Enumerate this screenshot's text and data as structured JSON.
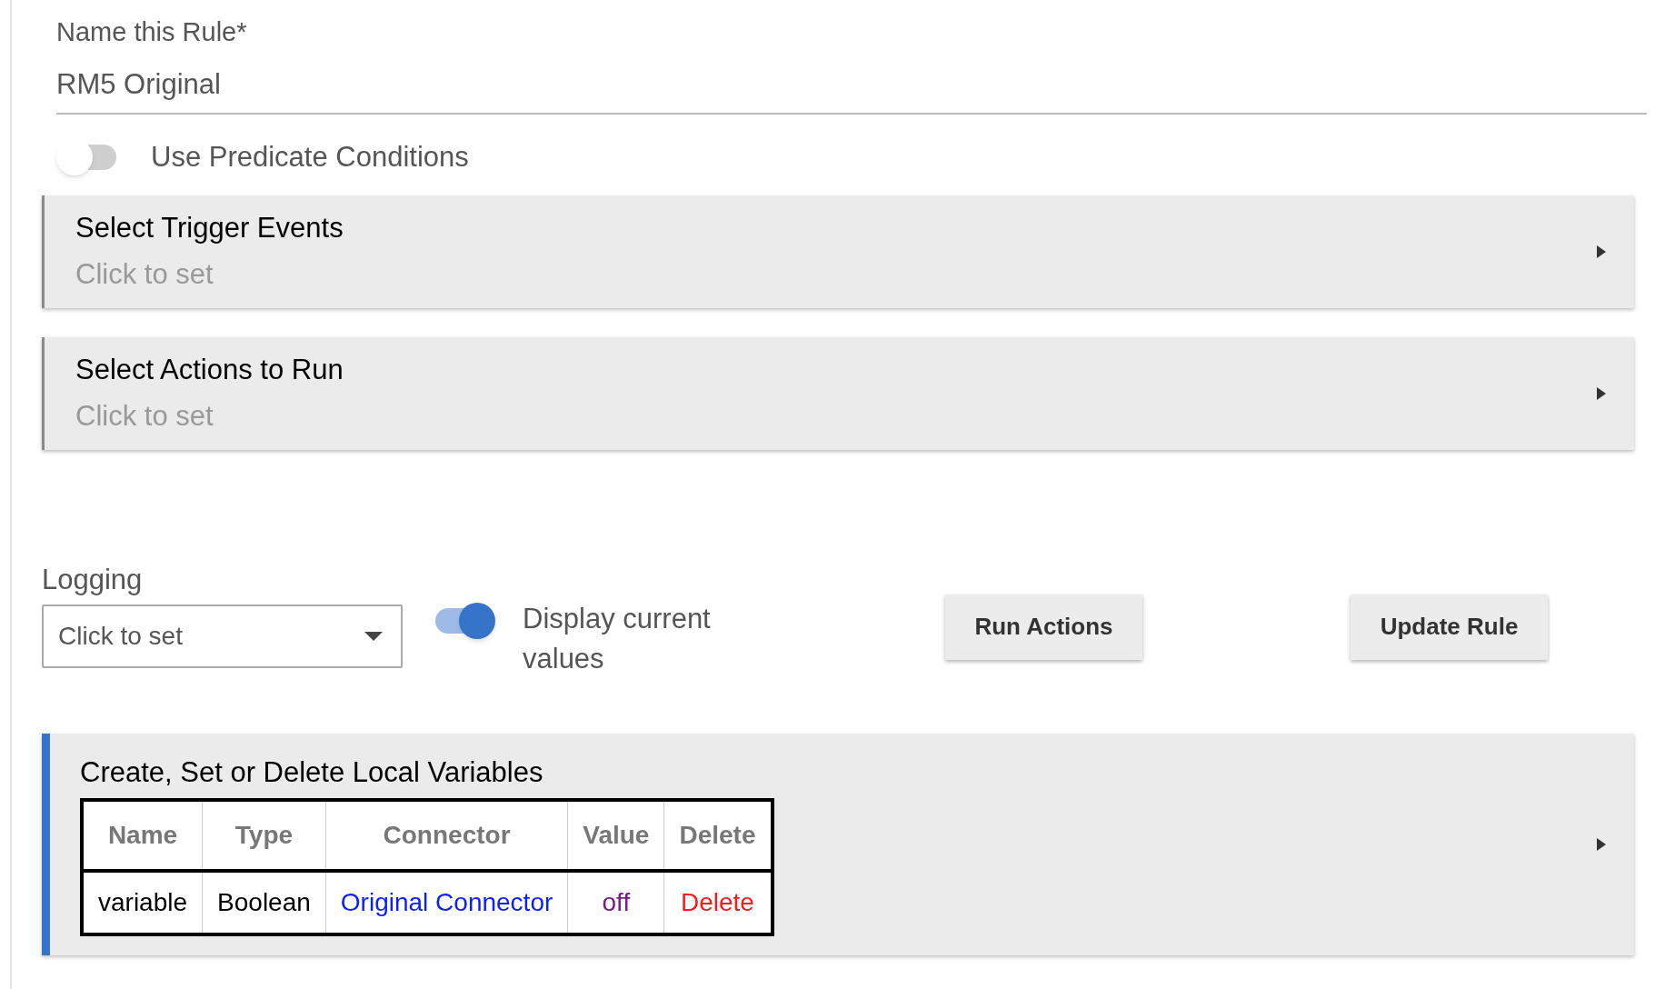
{
  "rule_name": {
    "label": "Name this Rule*",
    "value": "RM5 Original"
  },
  "predicate_switch": {
    "label": "Use Predicate Conditions",
    "on": false
  },
  "sections": [
    {
      "title": "Select Trigger Events",
      "subtitle": "Click to set"
    },
    {
      "title": "Select Actions to Run",
      "subtitle": "Click to set"
    }
  ],
  "logging": {
    "label": "Logging",
    "value": "Click to set"
  },
  "display_switch": {
    "label": "Display current values",
    "on": true
  },
  "buttons": [
    "Run Actions",
    "Update Rule"
  ],
  "variables": {
    "title": "Create, Set or Delete Local Variables",
    "columns": [
      "Name",
      "Type",
      "Connector",
      "Value",
      "Delete"
    ],
    "rows": [
      [
        {
          "text": "variable",
          "kind": "text"
        },
        {
          "text": "Boolean",
          "kind": "text"
        },
        {
          "text": "Original Connector",
          "kind": "link"
        },
        {
          "text": "off",
          "kind": "value"
        },
        {
          "text": "Delete",
          "kind": "delete"
        }
      ]
    ]
  }
}
